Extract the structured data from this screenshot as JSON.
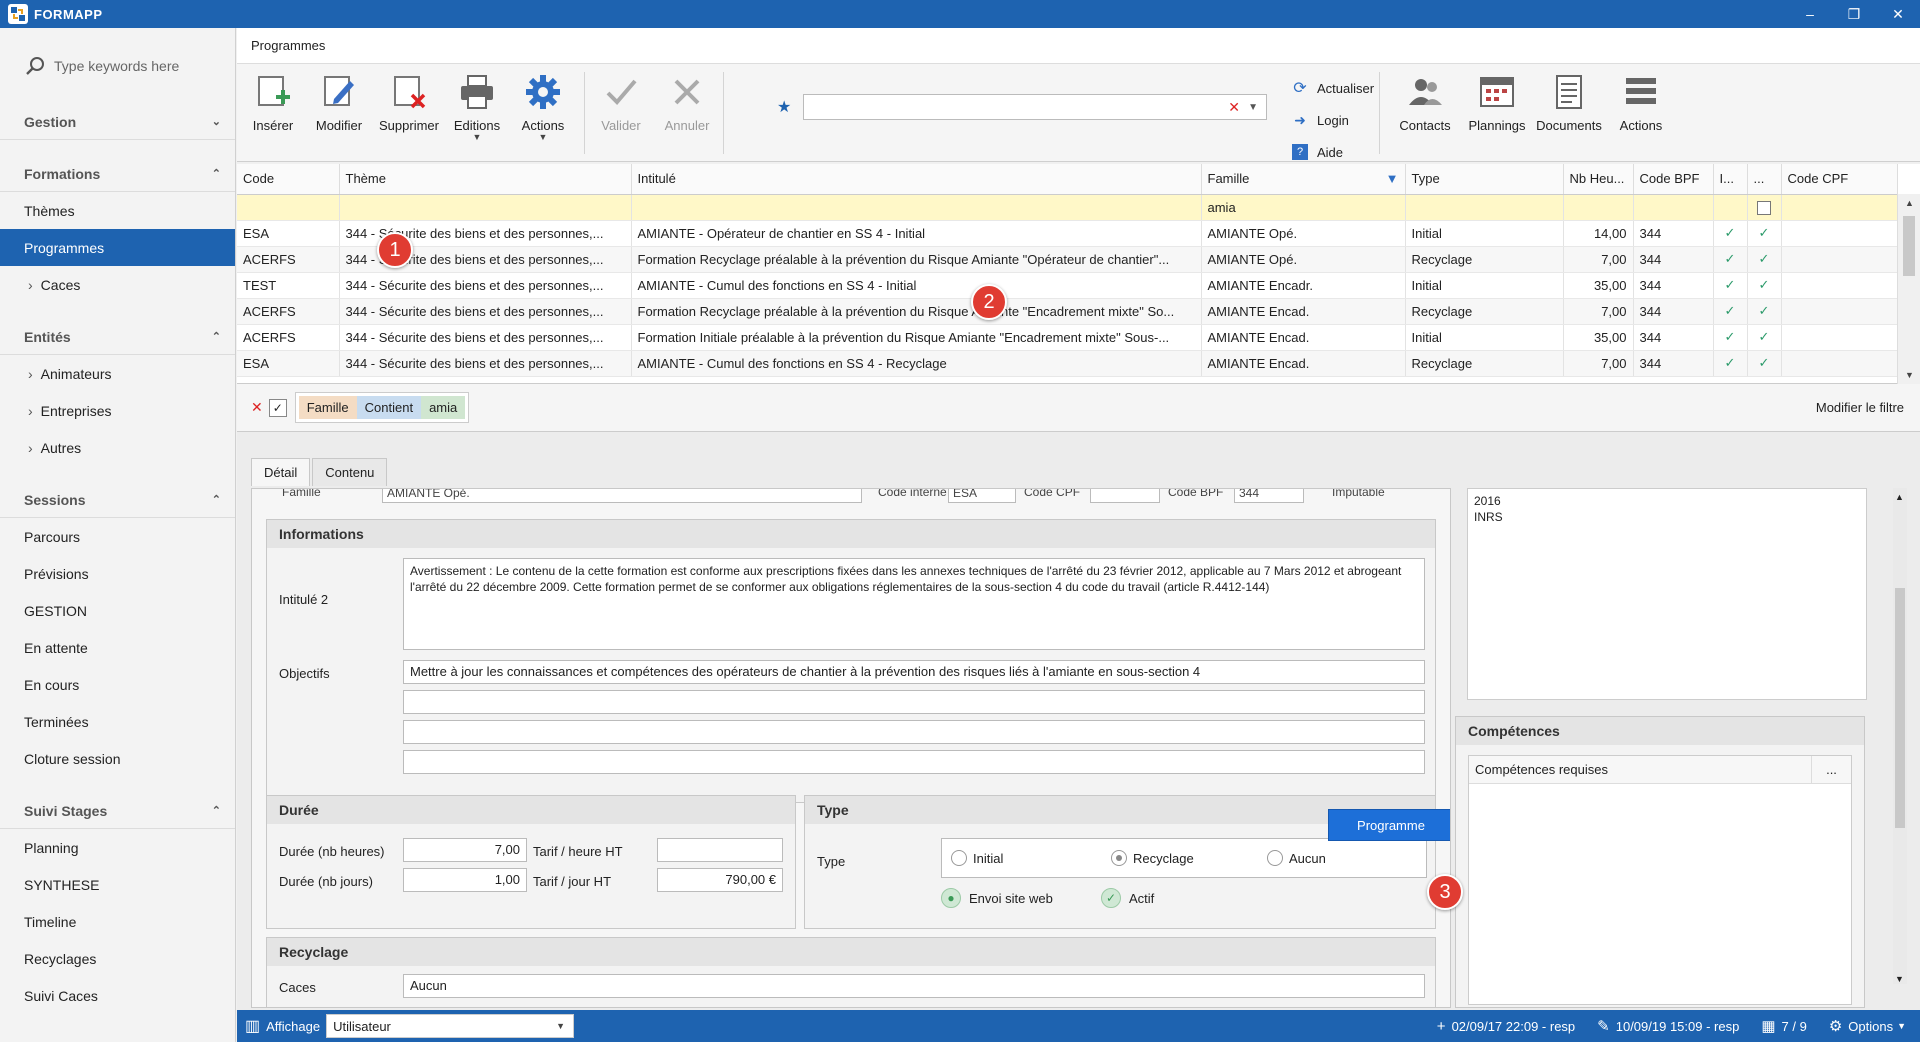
{
  "app": {
    "title": "FORMAPP"
  },
  "sidebar": {
    "search_placeholder": "Type keywords here",
    "groups": [
      {
        "label": "Gestion",
        "items": []
      },
      {
        "label": "Formations",
        "items": [
          {
            "label": "Thèmes",
            "sub": false
          },
          {
            "label": "Programmes",
            "sub": false,
            "active": true
          },
          {
            "label": "Caces",
            "sub": true
          }
        ]
      },
      {
        "label": "Entités",
        "items": [
          {
            "label": "Animateurs",
            "sub": true
          },
          {
            "label": "Entreprises",
            "sub": true
          },
          {
            "label": "Autres",
            "sub": true
          }
        ]
      },
      {
        "label": "Sessions",
        "items": [
          {
            "label": "Parcours"
          },
          {
            "label": "Prévisions"
          },
          {
            "label": "GESTION"
          },
          {
            "label": "En attente"
          },
          {
            "label": "En cours"
          },
          {
            "label": "Terminées"
          },
          {
            "label": "Cloture session"
          }
        ]
      },
      {
        "label": "Suivi Stages",
        "items": [
          {
            "label": "Planning"
          },
          {
            "label": "SYNTHESE"
          },
          {
            "label": "Timeline"
          },
          {
            "label": "Recyclages"
          },
          {
            "label": "Suivi Caces"
          }
        ]
      }
    ]
  },
  "breadcrumb": "Programmes",
  "ribbon": {
    "inserer": "Insérer",
    "modifier": "Modifier",
    "supprimer": "Supprimer",
    "editions": "Editions",
    "actions": "Actions",
    "valider": "Valider",
    "annuler": "Annuler",
    "actualiser": "Actualiser",
    "login": "Login",
    "aide": "Aide",
    "contacts": "Contacts",
    "plannings": "Plannings",
    "documents": "Documents",
    "actions2": "Actions"
  },
  "grid": {
    "columns": [
      "Code",
      "Thème",
      "Intitulé",
      "Famille",
      "Type",
      "Nb Heu...",
      "Code BPF",
      "I...",
      "...",
      "Code CPF"
    ],
    "filter_famille": "amia",
    "rows": [
      {
        "code": "ESA",
        "theme": "344 - Sécurite des biens et des personnes,...",
        "intitule": "AMIANTE - Opérateur de chantier en SS 4 - Initial",
        "famille": "AMIANTE Opé.",
        "type": "Initial",
        "heures": "14,00",
        "bpf": "344"
      },
      {
        "code": "ACERFS",
        "theme": "344 - Sécurite des biens et des personnes,...",
        "intitule": "Formation Recyclage préalable à la prévention du Risque Amiante \"Opérateur de chantier\"...",
        "famille": "AMIANTE Opé.",
        "type": "Recyclage",
        "heures": "7,00",
        "bpf": "344"
      },
      {
        "code": "TEST",
        "theme": "344 - Sécurite des biens et des personnes,...",
        "intitule": "AMIANTE - Cumul des fonctions en SS 4 - Initial",
        "famille": "AMIANTE Encadr.",
        "type": "Initial",
        "heures": "35,00",
        "bpf": "344"
      },
      {
        "code": "ACERFS",
        "theme": "344 - Sécurite des biens et des personnes,...",
        "intitule": "Formation Recyclage préalable à la prévention du Risque Amiante \"Encadrement mixte\" So...",
        "famille": "AMIANTE Encad.",
        "type": "Recyclage",
        "heures": "7,00",
        "bpf": "344"
      },
      {
        "code": "ACERFS",
        "theme": "344 - Sécurite des biens et des personnes,...",
        "intitule": "Formation Initiale préalable à la prévention du Risque Amiante \"Encadrement mixte\" Sous-...",
        "famille": "AMIANTE Encad.",
        "type": "Initial",
        "heures": "35,00",
        "bpf": "344"
      },
      {
        "code": "ESA",
        "theme": "344 - Sécurite des biens et des personnes,...",
        "intitule": "AMIANTE - Cumul des fonctions en SS 4 - Recyclage",
        "famille": "AMIANTE Encad.",
        "type": "Recyclage",
        "heures": "7,00",
        "bpf": "344"
      }
    ]
  },
  "filterbar": {
    "field": "Famille",
    "op": "Contient",
    "value": "amia",
    "modify": "Modifier le filtre"
  },
  "detail": {
    "tabs": [
      "Détail",
      "Contenu"
    ],
    "top_row": {
      "famille_label": "Famille",
      "famille_value": "AMIANTE Opé.",
      "code_interne_label": "Code interne",
      "code_interne_value": "ESA",
      "code_cpf_label": "Code CPF",
      "code_bpf_label": "Code BPF",
      "code_bpf_value": "344",
      "imputable_label": "Imputable"
    },
    "informations": {
      "title": "Informations",
      "intitule2_label": "Intitulé 2",
      "intitule2_value": "Avertissement : Le contenu de la cette formation est conforme aux prescriptions fixées dans les annexes techniques de l'arrêté du 23 février 2012, applicable au 7 Mars 2012 et abrogeant l'arrêté du 22 décembre 2009. Cette formation permet de se conformer aux obligations réglementaires de la sous-section 4 du code du travail (article R.4412-144)",
      "objectifs_label": "Objectifs",
      "objectifs_value": "Mettre à jour les connaissances et compétences des opérateurs de chantier à la prévention des risques liés à l'amiante en sous-section 4"
    },
    "duree": {
      "title": "Durée",
      "heures_label": "Durée (nb heures)",
      "heures_value": "7,00",
      "jours_label": "Durée (nb jours)",
      "jours_value": "1,00",
      "tarif_heure_label": "Tarif / heure HT",
      "tarif_heure_value": "",
      "tarif_jour_label": "Tarif / jour HT",
      "tarif_jour_value": "790,00 €"
    },
    "type": {
      "title": "Type",
      "label": "Type",
      "initial": "Initial",
      "recyclage": "Recyclage",
      "aucun": "Aucun",
      "envoi": "Envoi site web",
      "actif": "Actif",
      "programme_btn": "Programme"
    },
    "recyclage": {
      "title": "Recyclage",
      "caces_label": "Caces",
      "caces_value": "Aucun"
    },
    "right_memo": "2016\nINRS",
    "competences": {
      "title": "Compétences",
      "requises": "Compétences requises",
      "more": "..."
    }
  },
  "statusbar": {
    "affichage": "Affichage",
    "user": "Utilisateur",
    "created": "02/09/17 22:09 - resp",
    "modified": "10/09/19 15:09 - resp",
    "count": "7 / 9",
    "options": "Options"
  },
  "badges": [
    "1",
    "2",
    "3"
  ],
  "colors": {
    "accent": "#1e63b0",
    "badge": "#e03c32",
    "filter_row": "#fff8c8"
  }
}
